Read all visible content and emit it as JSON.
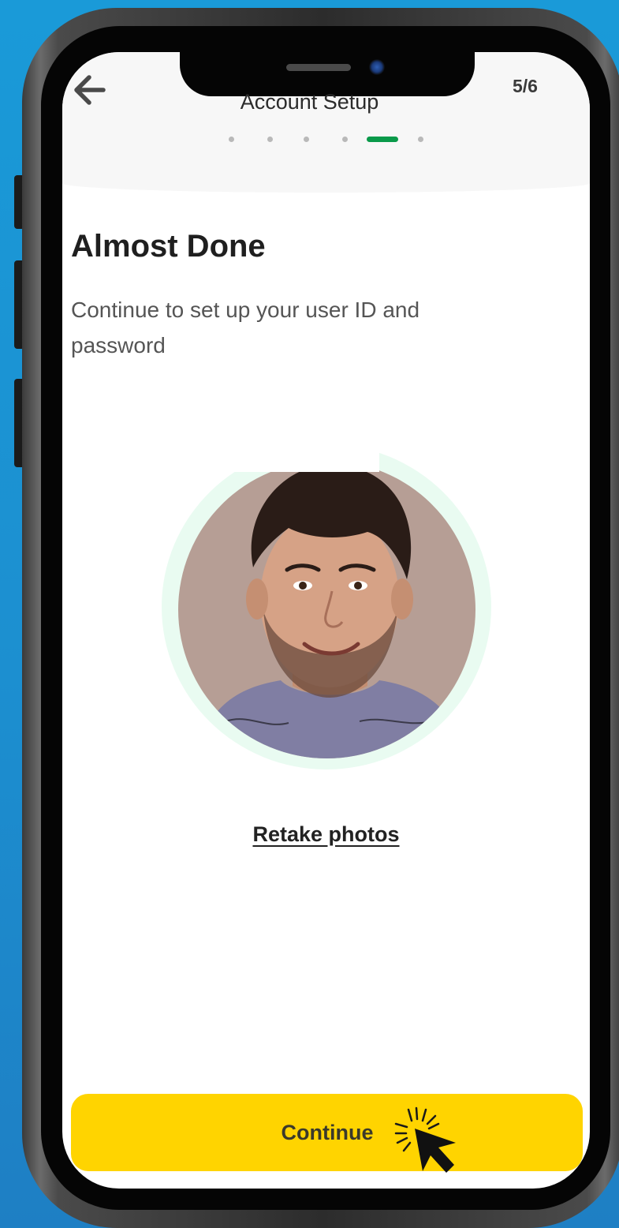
{
  "header": {
    "title": "Account Setup",
    "step_count": "5/6",
    "back_icon": "arrow-left-icon",
    "progress": {
      "total_steps": 6,
      "current_step": 5
    }
  },
  "main": {
    "headline": "Almost Done",
    "subtext": "Continue to set up your user ID and password",
    "photo_icon": "user-photo",
    "retake_link": "Retake photos"
  },
  "footer": {
    "continue_label": "Continue",
    "cursor_icon": "pointer-click-icon"
  },
  "colors": {
    "accent_green": "#0a9a4a",
    "button_yellow": "#ffd400",
    "background_blue": "#1a9ad8",
    "ring_mint": "#e9fbf1"
  }
}
